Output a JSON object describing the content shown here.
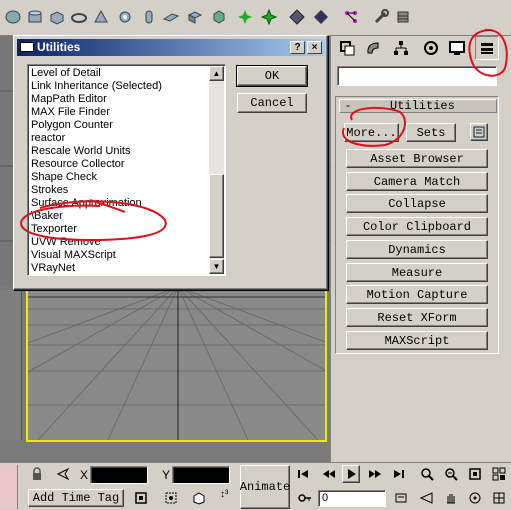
{
  "dialog": {
    "title": "Utilities",
    "help_label": "?",
    "close_label": "×",
    "ok_label": "OK",
    "cancel_label": "Cancel",
    "list_items": [
      "Level of Detail",
      "Link Inheritance (Selected)",
      "MapPath Editor",
      "MAX File Finder",
      "Polygon Counter",
      "reactor",
      "Rescale World Units",
      "Resource Collector",
      "Shape Check",
      "Strokes",
      "Surface Approximation",
      "\\Baker",
      "Texporter",
      "UVW Remove",
      "Visual MAXScript",
      "VRayNet"
    ]
  },
  "panel": {
    "rollout_title": "Utilities",
    "rollout_toggle": "-",
    "more_label": "More...",
    "sets_label": "Sets",
    "buttons": [
      "Asset Browser",
      "Camera Match",
      "Collapse",
      "Color Clipboard",
      "Dynamics",
      "Measure",
      "Motion Capture",
      "Reset XForm",
      "MAXScript"
    ]
  },
  "bottom": {
    "x_label": "X",
    "y_label": "Y",
    "animate_label": "Animate",
    "add_time_tag_label": "Add Time Tag",
    "frame_value": "0"
  },
  "colors": {
    "annotation_red": "#e0101a",
    "viewport_highlight": "#f0e800",
    "title_bar": "#0a246a"
  }
}
